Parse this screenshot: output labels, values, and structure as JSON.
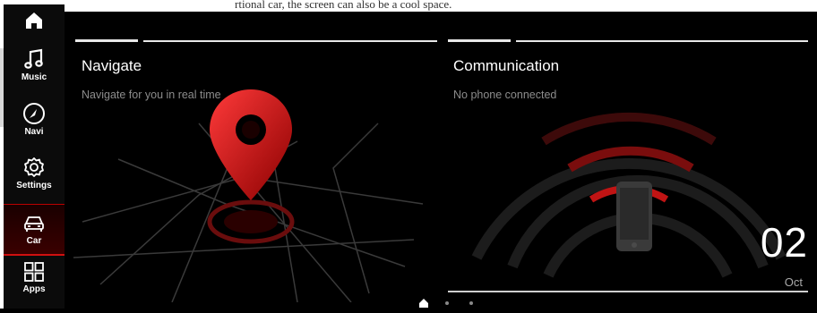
{
  "caption_fragment": "rtional car, the screen can also be a cool space.",
  "sidebar": {
    "items": [
      {
        "label": "",
        "icon": "home-icon"
      },
      {
        "label": "Music",
        "icon": "music-icon"
      },
      {
        "label": "Navi",
        "icon": "navi-icon"
      },
      {
        "label": "Settings",
        "icon": "gear-icon"
      },
      {
        "label": "Car",
        "icon": "car-icon",
        "active": true
      },
      {
        "label": "Apps",
        "icon": "apps-icon"
      }
    ]
  },
  "navigate_card": {
    "title": "Navigate",
    "subtitle": "Navigate for you in real time"
  },
  "communication_card": {
    "title": "Communication",
    "subtitle": "No phone connected",
    "date_day": "02",
    "date_month": "Oct"
  },
  "page_dots": {
    "count": 3,
    "active_index": 0,
    "active_icon": "home-icon"
  },
  "colors": {
    "accent": "#d01010",
    "background": "#000000"
  }
}
